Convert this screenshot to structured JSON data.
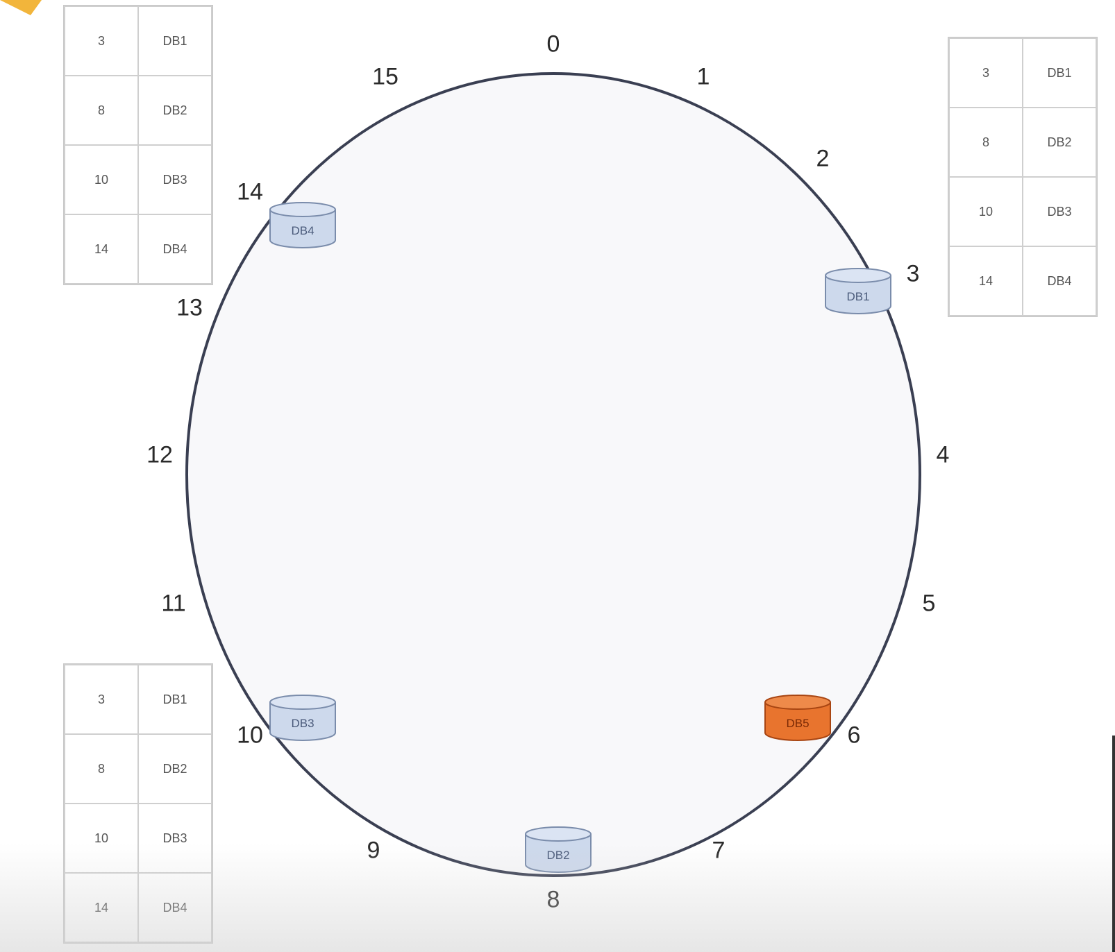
{
  "ring": {
    "positions": [
      "0",
      "1",
      "2",
      "3",
      "4",
      "5",
      "6",
      "7",
      "8",
      "9",
      "10",
      "11",
      "12",
      "13",
      "14",
      "15"
    ],
    "fill_color": "#f8f8fa",
    "stroke_color": "#3a3f52"
  },
  "tables": {
    "top_left": {
      "rows": [
        {
          "key": "3",
          "db": "DB1"
        },
        {
          "key": "8",
          "db": "DB2"
        },
        {
          "key": "10",
          "db": "DB3"
        },
        {
          "key": "14",
          "db": "DB4"
        }
      ]
    },
    "top_right": {
      "rows": [
        {
          "key": "3",
          "db": "DB1"
        },
        {
          "key": "8",
          "db": "DB2"
        },
        {
          "key": "10",
          "db": "DB3"
        },
        {
          "key": "14",
          "db": "DB4"
        }
      ]
    },
    "bottom_left": {
      "rows": [
        {
          "key": "3",
          "db": "DB1"
        },
        {
          "key": "8",
          "db": "DB2"
        },
        {
          "key": "10",
          "db": "DB3"
        },
        {
          "key": "14",
          "db": "DB4"
        }
      ]
    }
  },
  "nodes": {
    "db1": {
      "label": "DB1",
      "position": "3"
    },
    "db2": {
      "label": "DB2",
      "position": "8"
    },
    "db3": {
      "label": "DB3",
      "position": "10"
    },
    "db4": {
      "label": "DB4",
      "position": "14"
    },
    "db5": {
      "label": "DB5",
      "position": "6"
    }
  },
  "colors": {
    "db_fill": "#cdd9ec",
    "db_stroke": "#7a8cab",
    "new_db_fill": "#e8742e",
    "new_db_stroke": "#a84512",
    "corner_accent": "#f2b53b"
  },
  "icons": {
    "database": "database-cylinder-icon",
    "corner": "arrow-corner-icon"
  }
}
